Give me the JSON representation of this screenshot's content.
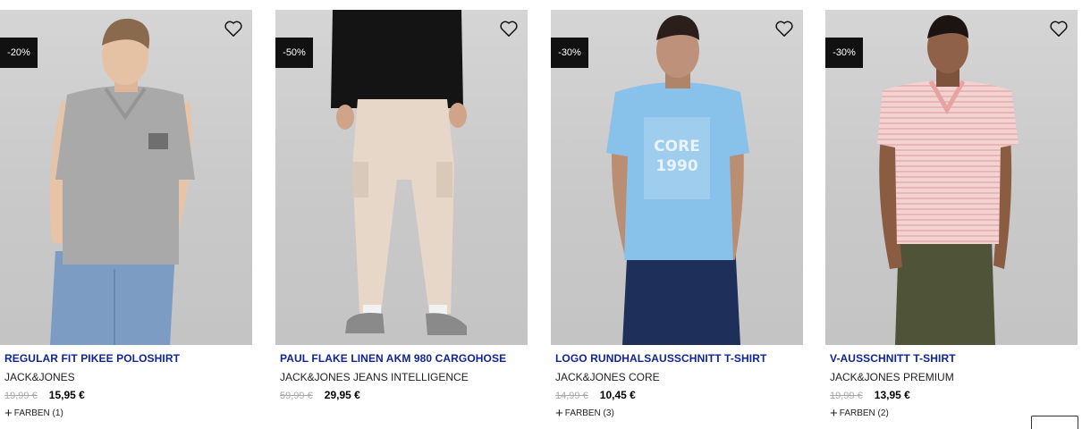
{
  "products": [
    {
      "badge": "-20%",
      "title": "REGULAR FIT PIKEE POLOSHIRT",
      "brand": "JACK&JONES",
      "old_price": "19,99 €",
      "price": "15,95 €",
      "colors_label": "FARBEN (1)",
      "icons": [
        "heart-icon",
        "plus-icon"
      ]
    },
    {
      "badge": "-50%",
      "title": "PAUL FLAKE LINEN AKM 980 CARGOHOSE",
      "brand": "JACK&JONES JEANS INTELLIGENCE",
      "old_price": "59,99 €",
      "price": "29,95 €",
      "colors_label": "",
      "icons": [
        "heart-icon"
      ]
    },
    {
      "badge": "-30%",
      "title": "LOGO RUNDHALSAUSSCHNITT T-SHIRT",
      "brand": "JACK&JONES CORE",
      "old_price": "14,99 €",
      "price": "10,45 €",
      "colors_label": "FARBEN (3)",
      "print_text": "CORE 1990",
      "icons": [
        "heart-icon",
        "plus-icon"
      ]
    },
    {
      "badge": "-30%",
      "title": "V-AUSSCHNITT T-SHIRT",
      "brand": "JACK&JONES PREMIUM",
      "old_price": "19,99 €",
      "price": "13,95 €",
      "colors_label": "FARBEN (2)",
      "icons": [
        "heart-icon",
        "plus-icon"
      ]
    }
  ],
  "colors": {
    "title_blue": "#10249a",
    "badge_bg": "#111111",
    "old_price_grey": "#a8a8a8"
  }
}
